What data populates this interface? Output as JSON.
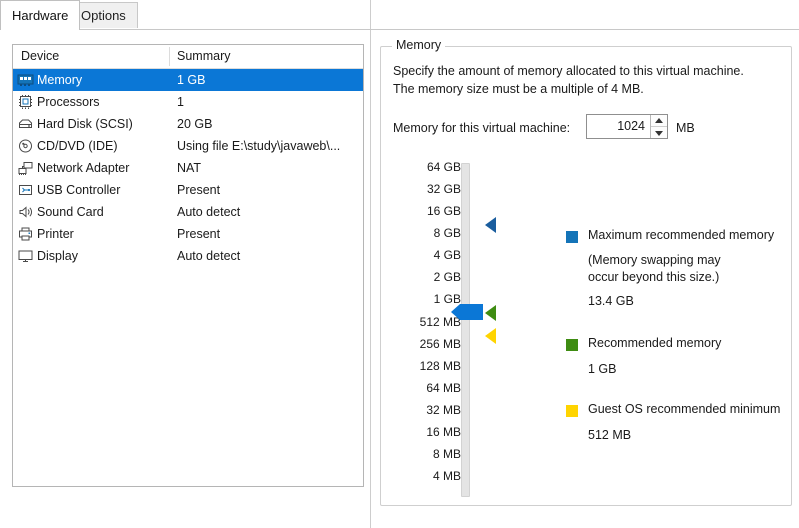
{
  "tabs": [
    {
      "label": "Hardware",
      "active": true
    },
    {
      "label": "Options",
      "active": false
    }
  ],
  "device_table": {
    "columns": [
      "Device",
      "Summary"
    ],
    "rows": [
      {
        "icon": "memory-icon",
        "device": "Memory",
        "summary": "1 GB",
        "selected": true
      },
      {
        "icon": "processor-icon",
        "device": "Processors",
        "summary": "1",
        "selected": false
      },
      {
        "icon": "hard-disk-icon",
        "device": "Hard Disk (SCSI)",
        "summary": "20 GB",
        "selected": false
      },
      {
        "icon": "cd-dvd-icon",
        "device": "CD/DVD (IDE)",
        "summary": "Using file E:\\study\\javaweb\\...",
        "selected": false
      },
      {
        "icon": "network-adapter-icon",
        "device": "Network Adapter",
        "summary": "NAT",
        "selected": false
      },
      {
        "icon": "usb-controller-icon",
        "device": "USB Controller",
        "summary": "Present",
        "selected": false
      },
      {
        "icon": "sound-card-icon",
        "device": "Sound Card",
        "summary": "Auto detect",
        "selected": false
      },
      {
        "icon": "printer-icon",
        "device": "Printer",
        "summary": "Present",
        "selected": false
      },
      {
        "icon": "display-icon",
        "device": "Display",
        "summary": "Auto detect",
        "selected": false
      }
    ]
  },
  "memory_panel": {
    "group_title": "Memory",
    "description_line1": "Specify the amount of memory allocated to this virtual machine.",
    "description_line2": "The memory size must be a multiple of 4 MB.",
    "field_label": "Memory for this virtual machine:",
    "field_value": "1024",
    "field_unit": "MB",
    "spinner_up": "▲",
    "spinner_down": "▼"
  },
  "scale": {
    "labels": [
      "64 GB",
      "32 GB",
      "16 GB",
      "8 GB",
      "4 GB",
      "2 GB",
      "1 GB",
      "512 MB",
      "256 MB",
      "128 MB",
      "64 MB",
      "32 MB",
      "16 MB",
      "8 MB",
      "4 MB"
    ],
    "current_position_label": "1 GB"
  },
  "legend": {
    "maximum": {
      "title": "Maximum recommended memory",
      "note_line1": "(Memory swapping may",
      "note_line2": "occur beyond this size.)",
      "value": "13.4 GB",
      "color": "#1474b8"
    },
    "recommended": {
      "title": "Recommended memory",
      "value": "1 GB",
      "color": "#3e8c12"
    },
    "guest_minimum": {
      "title": "Guest OS recommended minimum",
      "value": "512 MB",
      "color": "#ffd400"
    }
  },
  "colors": {
    "selection_blue": "#0b77d6",
    "slider_thumb": "#0b77d6",
    "marker_max": "#1a5d9e",
    "marker_recommended": "#3e8c12",
    "marker_minimum": "#ffd400"
  }
}
